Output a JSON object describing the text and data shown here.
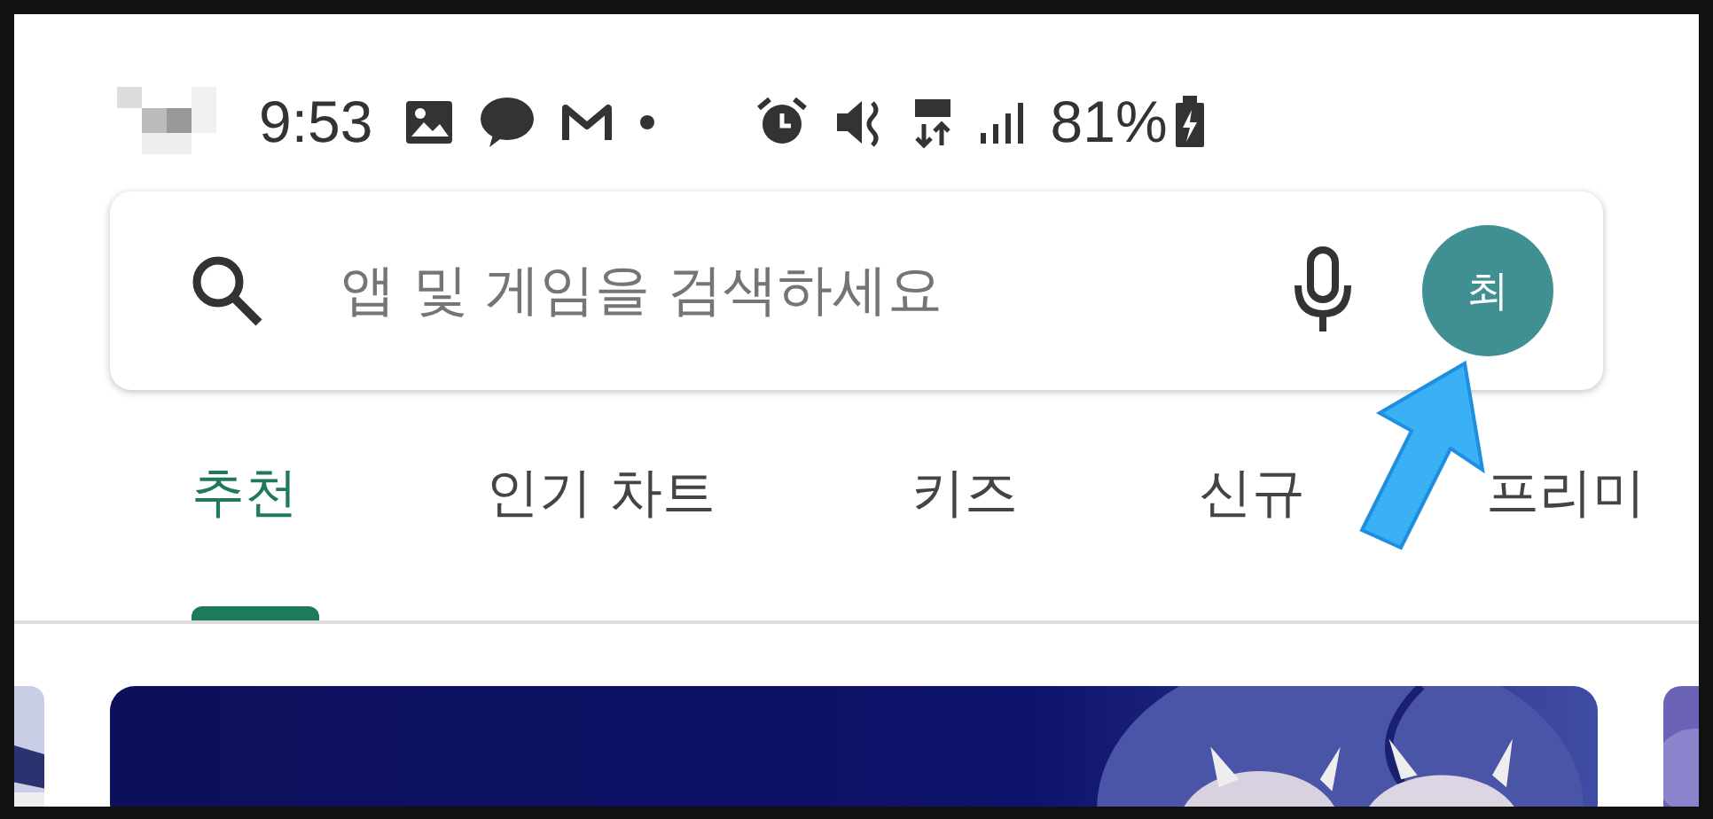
{
  "status_bar": {
    "time": "9:53",
    "battery": "81%"
  },
  "search": {
    "placeholder": "앱 및 게임을 검색하세요",
    "avatar": "최"
  },
  "tabs": [
    {
      "label": "추천",
      "selected": true
    },
    {
      "label": "인기 차트",
      "selected": false
    },
    {
      "label": "키즈",
      "selected": false
    },
    {
      "label": "신규",
      "selected": false
    },
    {
      "label": "프리미",
      "selected": false
    }
  ]
}
